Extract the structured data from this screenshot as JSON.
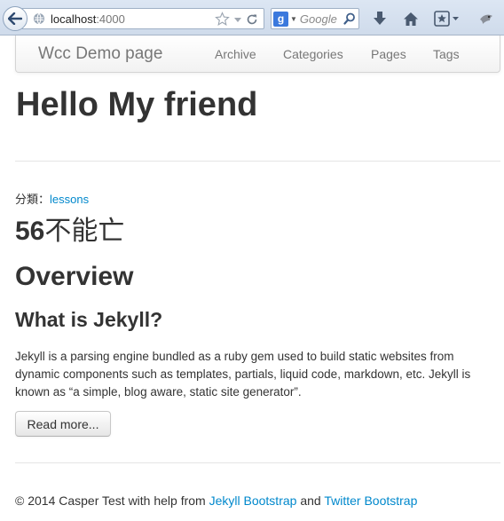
{
  "browser": {
    "url_host": "localhost",
    "url_port": ":4000",
    "search_placeholder": "Google",
    "search_engine_letter": "g",
    "icons": [
      "back-arrow-icon",
      "globe-icon",
      "star-icon",
      "dropdown-arrow-icon",
      "reload-icon",
      "search-icon",
      "download-icon",
      "home-icon",
      "bookmarks-icon",
      "addon-icon"
    ]
  },
  "navbar": {
    "brand": "Wcc Demo page",
    "links": [
      "Archive",
      "Categories",
      "Pages",
      "Tags"
    ]
  },
  "page": {
    "title": "Hello My friend"
  },
  "post": {
    "category_prefix": "分類：",
    "category": "lessons",
    "title_number": "56",
    "title_text": "不能亡",
    "heading_overview": "Overview",
    "heading_jekyll": "What is Jekyll?",
    "excerpt": "Jekyll is a parsing engine bundled as a ruby gem used to build static websites from dynamic components such as templates, partials, liquid code, markdown, etc. Jekyll is known as “a simple, blog aware, static site generator”.",
    "read_more": "Read more..."
  },
  "footer": {
    "prefix": "© 2014 Casper Test with help from ",
    "link1": "Jekyll Bootstrap",
    "and": " and ",
    "link2": "Twitter Bootstrap"
  },
  "colors": {
    "link": "#0088cc",
    "text": "#333333",
    "nav_text": "#777777"
  }
}
